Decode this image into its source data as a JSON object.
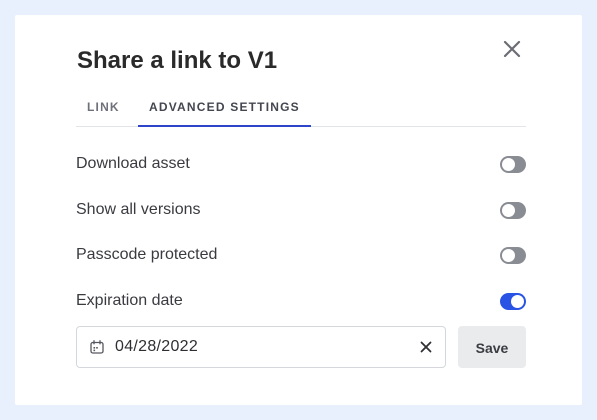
{
  "dialog": {
    "title": "Share a link to V1",
    "close_icon": "close-icon"
  },
  "tabs": [
    {
      "label": "LINK",
      "active": false
    },
    {
      "label": "ADVANCED SETTINGS",
      "active": true
    }
  ],
  "settings": [
    {
      "label": "Download asset",
      "enabled": false
    },
    {
      "label": "Show all versions",
      "enabled": false
    },
    {
      "label": "Passcode protected",
      "enabled": false
    },
    {
      "label": "Expiration date",
      "enabled": true
    }
  ],
  "expiration": {
    "date_value": "04/28/2022",
    "calendar_icon": "calendar-icon",
    "clear_icon": "clear-icon"
  },
  "save_label": "Save",
  "colors": {
    "accent": "#2853e5",
    "tab_underline": "#2f45c9",
    "toggle_off": "#8a8c93",
    "page_background": "#e8f0fd"
  }
}
